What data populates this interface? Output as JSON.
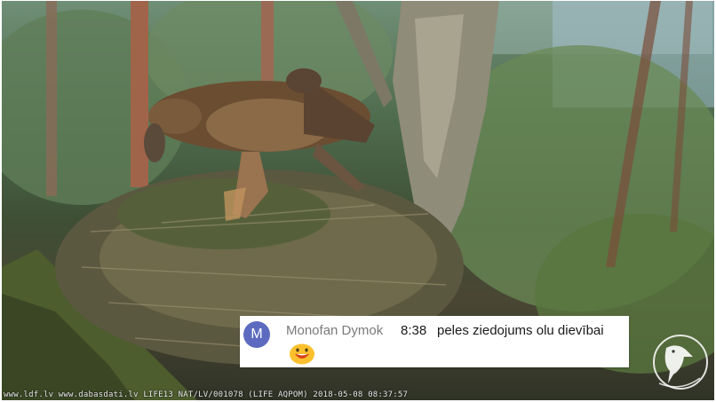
{
  "comment": {
    "avatar_letter": "M",
    "author": "Monofan Dymok",
    "timestamp": "8:38",
    "text": "peles ziedojums olu dievībai",
    "emoji": "smiling-face-emoji"
  },
  "overlay": {
    "caption": "www.ldf.lv www.dabasdati.lv LIFE13 NAT/LV/001078 (LIFE AQPOM) 2018-05-08 08:37:57"
  },
  "colors": {
    "avatar": "#5c6bc0",
    "author_text": "#7a7a7a",
    "comment_text": "#1a1a1a",
    "emoji_face": "#fbc02d"
  }
}
